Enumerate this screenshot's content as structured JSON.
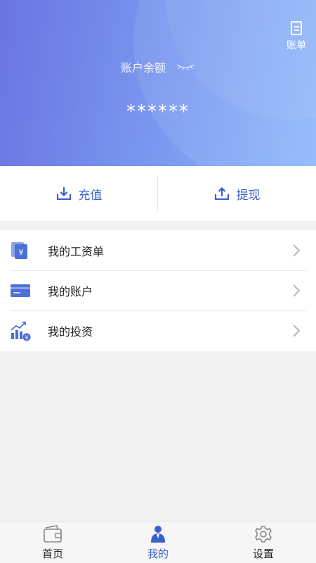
{
  "header": {
    "bill_label": "账单",
    "balance_label": "账户余额",
    "balance_value": "******"
  },
  "actions": [
    {
      "label": "充值",
      "icon": "download-tray-icon"
    },
    {
      "label": "提现",
      "icon": "upload-tray-icon"
    }
  ],
  "menu": [
    {
      "label": "我的工资单",
      "icon": "payslip-yuan-icon"
    },
    {
      "label": "我的账户",
      "icon": "card-icon"
    },
    {
      "label": "我的投资",
      "icon": "growth-chart-icon"
    }
  ],
  "nav": [
    {
      "label": "首页",
      "icon": "wallet-icon",
      "active": false
    },
    {
      "label": "我的",
      "icon": "person-icon",
      "active": true
    },
    {
      "label": "设置",
      "icon": "gear-icon",
      "active": false
    }
  ],
  "colors": {
    "accent": "#3b5fcf",
    "header_start": "#6a74e2",
    "header_end": "#8fb8fb"
  }
}
